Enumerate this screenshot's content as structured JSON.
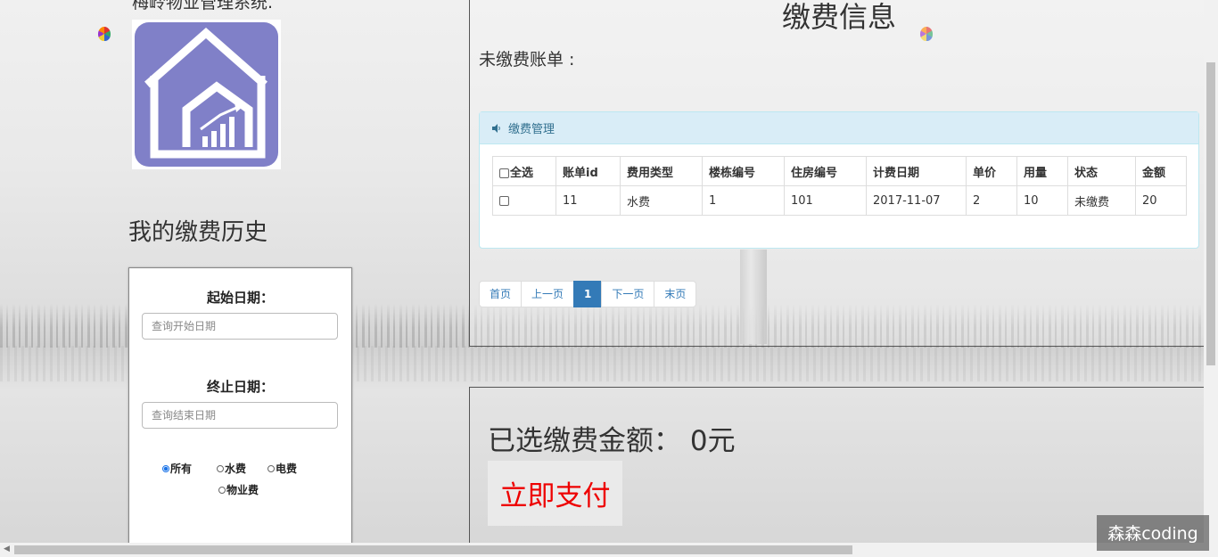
{
  "left": {
    "system_title": "梅岭物业管理系统.",
    "history_title": "我的缴费历史",
    "filter": {
      "start_label": "起始日期：",
      "start_placeholder": "查询开始日期",
      "end_label": "终止日期：",
      "end_placeholder": "查询结束日期",
      "options": [
        "所有",
        "水费",
        "电费",
        "物业费"
      ],
      "selected": "所有"
    }
  },
  "main": {
    "heading": "缴费信息",
    "unpaid_label": "未缴费账单 :",
    "panel_title": "缴费管理",
    "table": {
      "headers": [
        "全选",
        "账单id",
        "费用类型",
        "楼栋编号",
        "住房编号",
        "计费日期",
        "单价",
        "用量",
        "状态",
        "金额"
      ],
      "rows": [
        [
          "",
          "11",
          "水费",
          "1",
          "101",
          "2017-11-07",
          "2",
          "10",
          "未缴费",
          "20"
        ]
      ]
    },
    "pagination": [
      "首页",
      "上一页",
      "1",
      "下一页",
      "末页"
    ],
    "active_page": "1",
    "selected_amount": "已选缴费金额： 0元",
    "pay_button": "立即支付"
  },
  "watermark": "森森coding",
  "colors": {
    "panel_heading_bg": "#d9edf7",
    "panel_heading_text": "#31708f",
    "active_page": "#337ab7",
    "pay_button_text": "#ee0000",
    "logo_bg": "#8080c8"
  },
  "icons": {
    "panel_icon": "volume-icon",
    "logo": "house-chart-icon",
    "balloon": "balloon-icon"
  }
}
